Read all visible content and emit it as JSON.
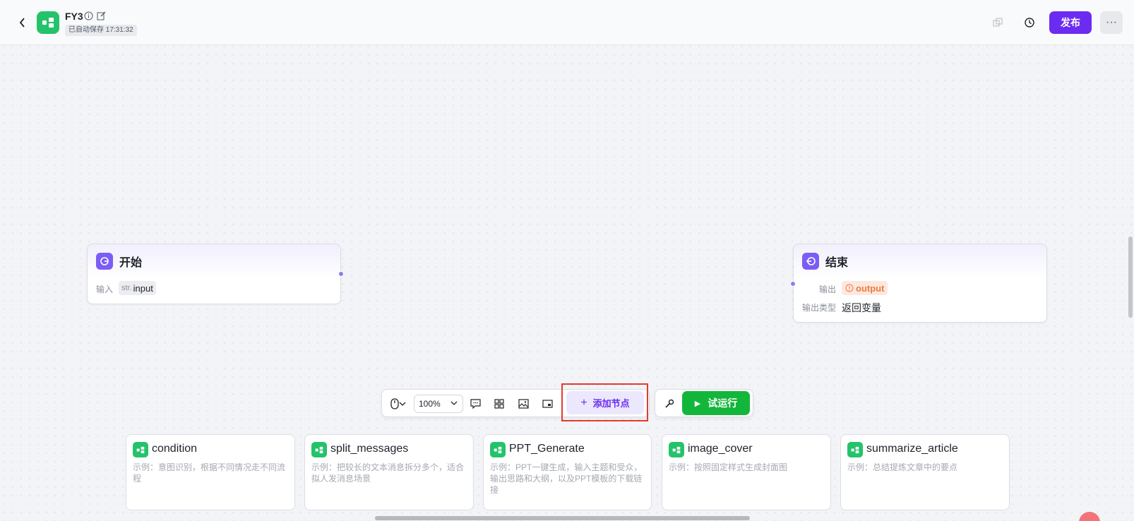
{
  "header": {
    "title": "FY3",
    "autosave": "已自动保存 17:31:32",
    "publish_label": "发布",
    "more_label": "···"
  },
  "nodes": {
    "start": {
      "title": "开始",
      "input_label": "输入",
      "param_type": "str.",
      "param_name": "input"
    },
    "end": {
      "title": "结束",
      "output_label": "输出",
      "output_value": "output",
      "output_type_label": "输出类型",
      "output_type_value": "返回变量"
    }
  },
  "toolbar": {
    "zoom": "100%",
    "add_node_label": "添加节点",
    "run_label": "试运行"
  },
  "cards": [
    {
      "title": "condition",
      "desc": "示例：意图识别，根据不同情况走不同流程"
    },
    {
      "title": "split_messages",
      "desc": "示例：把较长的文本消息拆分多个，适合拟人发消息场景"
    },
    {
      "title": "PPT_Generate",
      "desc": "示例：PPT一键生成，输入主题和受众，输出思路和大纲，以及PPT模板的下载链接"
    },
    {
      "title": "image_cover",
      "desc": "示例：按照固定样式生成封面图"
    },
    {
      "title": "summarize_article",
      "desc": "示例：总结提炼文章中的要点"
    }
  ],
  "colors": {
    "accent": "#6c2bf0",
    "run": "#12b63b",
    "app_icon": "#24c36b",
    "node_icon": "#7b5cf5",
    "highlight": "#e43a2f"
  }
}
